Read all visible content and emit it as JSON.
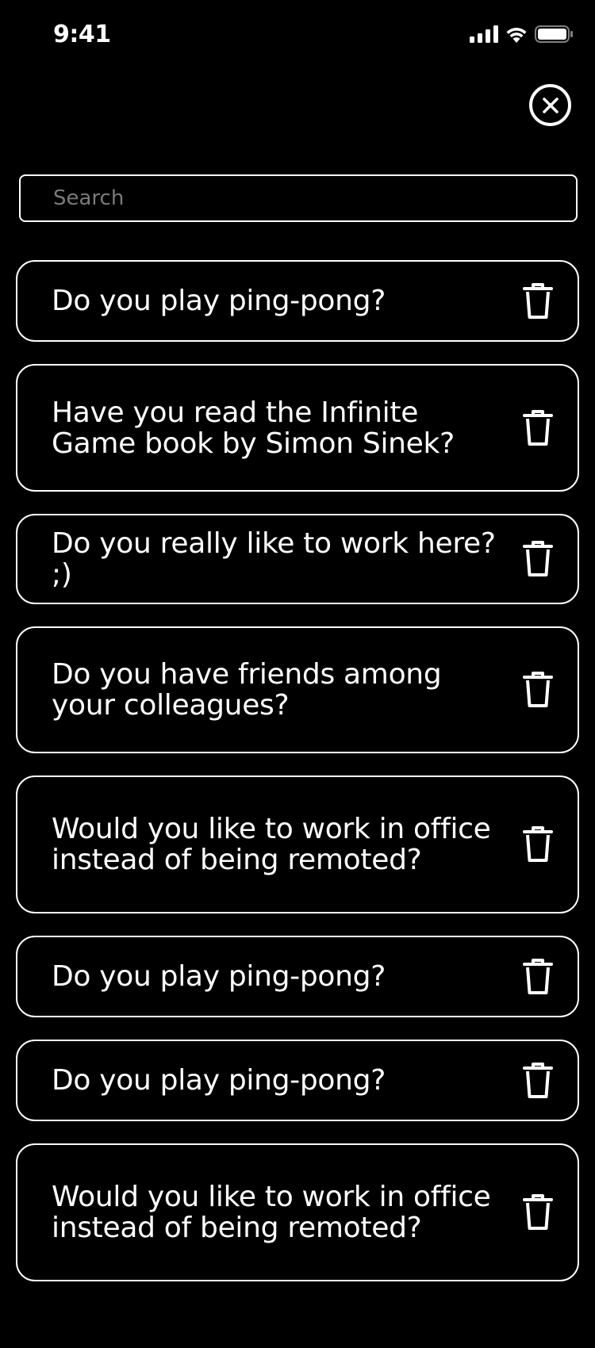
{
  "status_bar": {
    "time": "9:41"
  },
  "search": {
    "placeholder": "Search",
    "value": ""
  },
  "questions": [
    {
      "text": "Do you play ping-pong?"
    },
    {
      "text": "Have you read the Infinite Game book by Simon Sinek?"
    },
    {
      "text": "Do you really like to work here? ;)"
    },
    {
      "text": "Do you have friends among your colleagues?"
    },
    {
      "text": "Would you like to work in office instead of being remoted?"
    },
    {
      "text": "Do you play ping-pong?"
    },
    {
      "text": "Do you play ping-pong?"
    },
    {
      "text": "Would you like to work in office instead of being remoted?"
    }
  ],
  "icons": {
    "close": "close-icon",
    "delete": "trash-icon",
    "signal": "cellular-signal-icon",
    "wifi": "wifi-icon",
    "battery": "battery-icon"
  },
  "colors": {
    "background": "#000000",
    "foreground": "#ffffff",
    "placeholder": "#7a7a7a"
  }
}
